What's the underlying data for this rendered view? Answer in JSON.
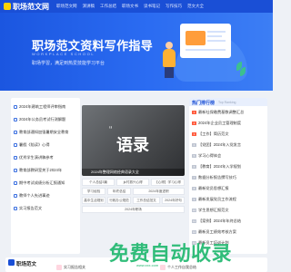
{
  "logo": {
    "text": "职场范文网"
  },
  "nav": [
    "职场范文网",
    "演讲稿",
    "工作总结",
    "职场文书",
    "读书笔记",
    "写作技巧",
    "范文大全"
  ],
  "hero": {
    "title": "职场范文资料写作指导",
    "subtitle": "WORKPLACE SCHOOL",
    "desc": "职场学習，满足到热爱技能学习平台"
  },
  "left_list": [
    "2024年建筑工程师评审指南",
    "2024年公务员考试行测解题",
    "教育部通知加强暑期安全教育",
    "暑假《陪读》心得",
    "优秀学生演讲稿参考",
    "教育部教研室关于2024年",
    "期中考试成绩分析汇报通知",
    "教师个人先进事迹",
    "实习报告范文"
  ],
  "feature": {
    "word": "语录",
    "caption": "2024年整理网络经典语录大全"
  },
  "tags": [
    "个人总结3篇",
    "乡村振兴心得",
    "【心得】学习心得",
    "学习经验",
    "年终总结",
    "2024年度述职",
    "高中生活规划",
    "行政办公规范",
    "工作总结范文",
    "2024年好句",
    "2024年职场"
  ],
  "hot": {
    "title": "热门排行榜",
    "subtitle": "Top Ranking",
    "items": [
      "最新社保缴费基数调整汇总",
      "2024年企业员工管理制度",
      "【工作】简历范文",
      "【党团】2024年入党发言",
      "学习心得体会",
      "【教育】2024年入学规划",
      "数据分析报告撰写技巧",
      "最新党员思想汇报",
      "最新发展党员工作流程",
      "学生思想汇报范文",
      "【案例】2024年年终总结",
      "最新员工绩效考核方案",
      "最新员工培训计划"
    ]
  },
  "bottom": {
    "title": "职场范文",
    "items": [
      "实习报告相关",
      "个人工作自我总结"
    ]
  },
  "watermark": {
    "text": "免费自动收录",
    "sub": "www.xxx.com"
  },
  "colors": {
    "brand": "#1a4fd6",
    "accent": "#ff5a3c",
    "watermark": "#20b86f"
  }
}
